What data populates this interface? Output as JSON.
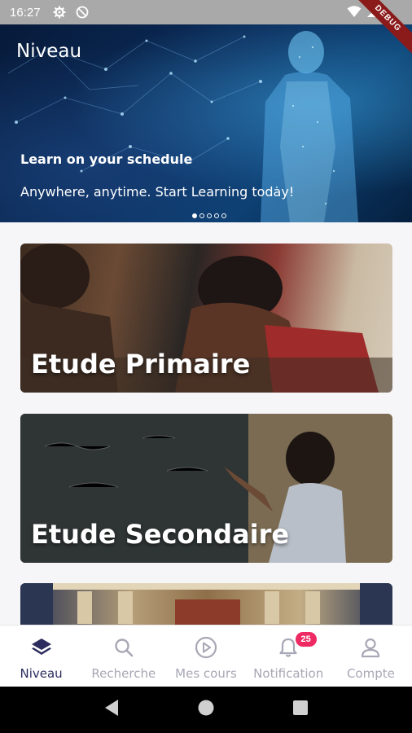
{
  "status_bar": {
    "time": "16:27",
    "debug_label": "DEBUG",
    "icons": [
      "gear-icon",
      "at-sign-icon",
      "wifi-icon",
      "cellular-icon",
      "battery-icon"
    ]
  },
  "banner": {
    "title": "Niveau",
    "headline": "Learn on your schedule",
    "subtitle": "Anywhere, anytime. Start Learning today!",
    "slide_count": 5,
    "active_slide": 1
  },
  "levels": [
    {
      "label": "Etude Primaire"
    },
    {
      "label": "Etude Secondaire"
    },
    {
      "label": ""
    }
  ],
  "bottom_nav": {
    "items": [
      {
        "label": "Niveau",
        "icon": "layers-icon",
        "active": true
      },
      {
        "label": "Recherche",
        "icon": "search-icon",
        "active": false
      },
      {
        "label": "Mes cours",
        "icon": "play-circle-icon",
        "active": false
      },
      {
        "label": "Notification",
        "icon": "bell-icon",
        "active": false,
        "badge": "25"
      },
      {
        "label": "Compte",
        "icon": "user-icon",
        "active": false
      }
    ]
  },
  "colors": {
    "accent": "#2c2d5e",
    "inactive": "#a7a7b5",
    "badge": "#ee2a63"
  }
}
